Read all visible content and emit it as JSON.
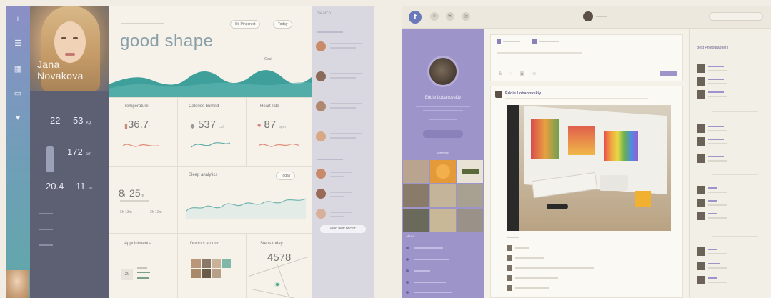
{
  "left_screen": {
    "rail_icons": [
      "plus-icon",
      "sliders-icon",
      "calendar-icon",
      "clipboard-icon",
      "heart-icon"
    ],
    "profile": {
      "first_name": "Jana",
      "last_name": "Novakova",
      "stats": [
        {
          "value": "22",
          "unit": ""
        },
        {
          "value": "53",
          "unit": "kg"
        },
        {
          "value": "172",
          "unit": "cm"
        },
        {
          "value": "20.4",
          "unit": ""
        },
        {
          "value": "11",
          "unit": "%"
        }
      ]
    },
    "main": {
      "headline": "good shape",
      "selectors": [
        "St. Pinecrest",
        "Today"
      ],
      "goal_label": "Goal",
      "cards": [
        {
          "title": "Temperature",
          "value": "36.7",
          "unit": "°"
        },
        {
          "title": "Calories burned",
          "value": "537",
          "unit": "cal"
        },
        {
          "title": "Heart rate",
          "value": "87",
          "unit": "bpm"
        }
      ],
      "sleep": {
        "title": "Sleep analytics",
        "selector": "Today",
        "hours": "8",
        "minutes": "25",
        "sub_values": [
          "6h 13m",
          "2h 12m"
        ]
      },
      "appointments": {
        "title": "Appointments",
        "day": "29"
      },
      "doctors": {
        "title": "Doctors around"
      },
      "steps": {
        "title": "Steps today",
        "value": "4578"
      }
    },
    "friends": {
      "search_placeholder": "Search",
      "find_button": "Find new doctor"
    }
  },
  "right_screen": {
    "sidebar": {
      "user_name": "Eddie Lobanovskiy",
      "photos_heading": "Photos",
      "about_heading": "About"
    },
    "feed": {
      "post_author": "Eddie Lobanovskiy"
    },
    "right_column": {
      "title": "Best Photographers"
    }
  }
}
